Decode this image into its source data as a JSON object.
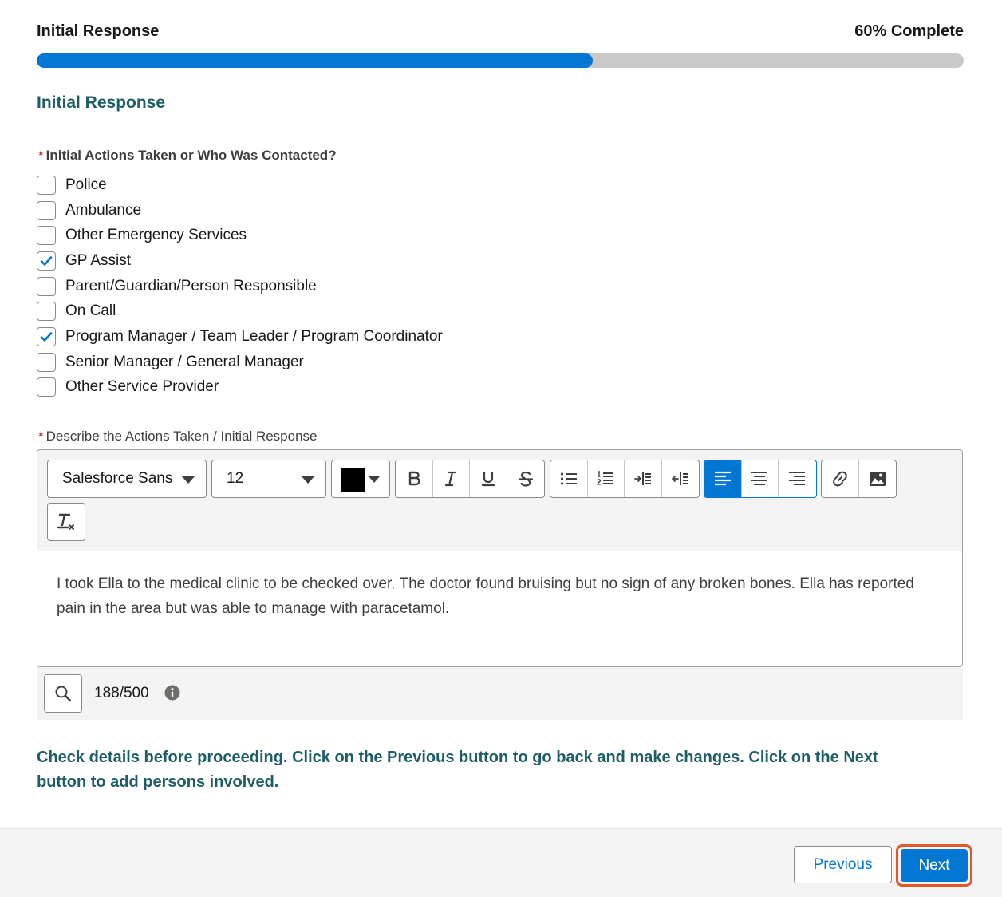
{
  "header": {
    "title": "Initial Response",
    "progress_label": "60% Complete",
    "progress_fraction": 0.6
  },
  "section": {
    "title": "Initial Response"
  },
  "question": {
    "required_mark": "*",
    "label": "Initial Actions Taken or Who Was Contacted?",
    "options": [
      {
        "label": "Police",
        "checked": false
      },
      {
        "label": "Ambulance",
        "checked": false
      },
      {
        "label": "Other Emergency Services",
        "checked": false
      },
      {
        "label": "GP Assist",
        "checked": true
      },
      {
        "label": "Parent/Guardian/Person Responsible",
        "checked": false
      },
      {
        "label": "On Call",
        "checked": false
      },
      {
        "label": "Program Manager / Team Leader / Program Coordinator",
        "checked": true
      },
      {
        "label": "Senior Manager / General Manager",
        "checked": false
      },
      {
        "label": "Other Service Provider",
        "checked": false
      }
    ]
  },
  "description": {
    "required_mark": "*",
    "label": "Describe the Actions Taken / Initial Response",
    "font_family_value": "Salesforce Sans",
    "font_size_value": "12",
    "text_color": "#000000",
    "active_alignment": "align-left",
    "text": "I took Ella to the medical clinic to be checked over. The doctor found bruising but no sign of any broken bones. Ella has reported pain in the area but was able to manage with paracetamol.",
    "char_count": "188/500"
  },
  "notice": "Check details before proceeding. Click on the Previous button to go back and make changes. Click on the Next button to add persons involved.",
  "nav": {
    "previous_label": "Previous",
    "next_label": "Next"
  },
  "colors": {
    "brand": "#0176d3",
    "heading": "#1d5e66",
    "required": "#ba0517",
    "focus_ring": "#e0582a"
  }
}
